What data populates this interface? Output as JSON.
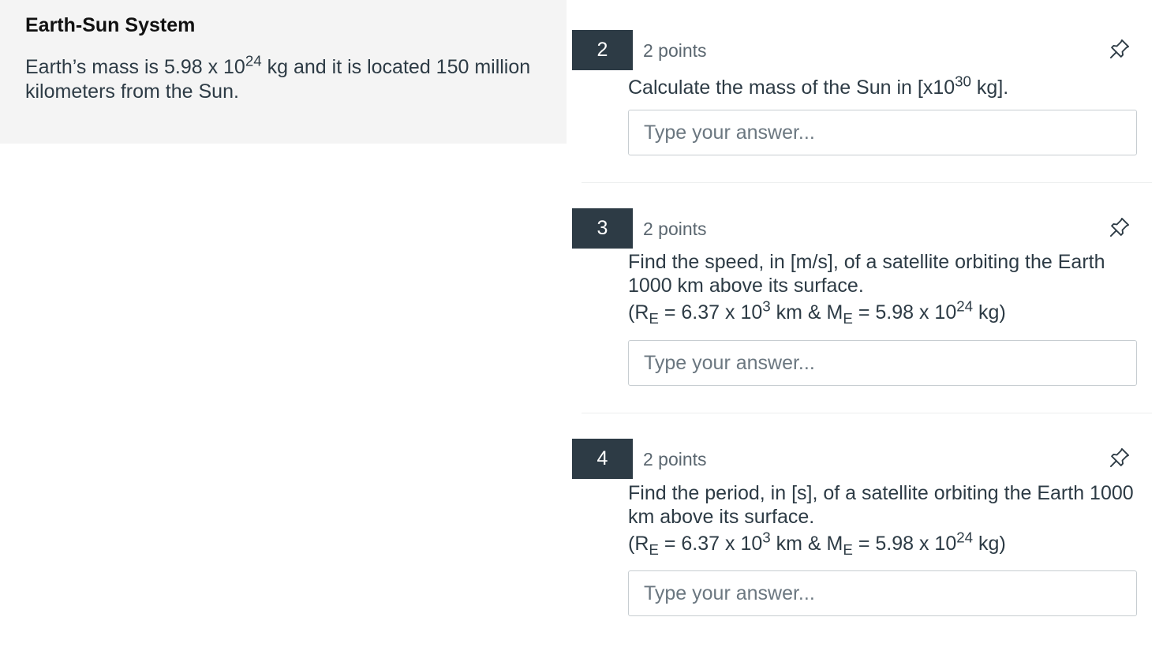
{
  "context": {
    "title": "Earth-Sun System",
    "text_part1": "Earth’s mass is 5.98 x 10",
    "text_sup": "24",
    "text_part2": " kg and it is located 150 million kilometers from the Sun."
  },
  "questions": [
    {
      "number": "2",
      "points": "2 points",
      "text_part1": "Calculate the mass of the Sun in [x10",
      "text_sup": "30",
      "text_part2": " kg].",
      "answer_placeholder": "Type your answer...",
      "answer_value": ""
    },
    {
      "number": "3",
      "points": "2 points",
      "text": "Find the speed, in [m/s], of a satellite orbiting the Earth 1000 km above its surface.",
      "formula": {
        "open": "(R",
        "sub1": "E",
        "mid1": " = 6.37 x 10",
        "sup1": "3",
        "mid2": " km & M",
        "sub2": "E",
        "mid3": " = 5.98 x 10",
        "sup2": "24",
        "close": " kg)"
      },
      "answer_placeholder": "Type your answer...",
      "answer_value": ""
    },
    {
      "number": "4",
      "points": "2 points",
      "text": "Find the period, in [s], of a satellite orbiting the Earth 1000 km above its surface.",
      "formula": {
        "open": "(R",
        "sub1": "E",
        "mid1": " = 6.37 x 10",
        "sup1": "3",
        "mid2": " km & M",
        "sub2": "E",
        "mid3": " = 5.98 x 10",
        "sup2": "24",
        "close": " kg)"
      },
      "answer_placeholder": "Type your answer...",
      "answer_value": ""
    }
  ],
  "icons": {
    "pin": "pin-icon"
  },
  "colors": {
    "badge_bg": "#2d3b45",
    "context_bg": "#f4f4f4",
    "text": "#2d3b45",
    "muted": "#5b6770",
    "input_border": "#c7cdd1"
  }
}
